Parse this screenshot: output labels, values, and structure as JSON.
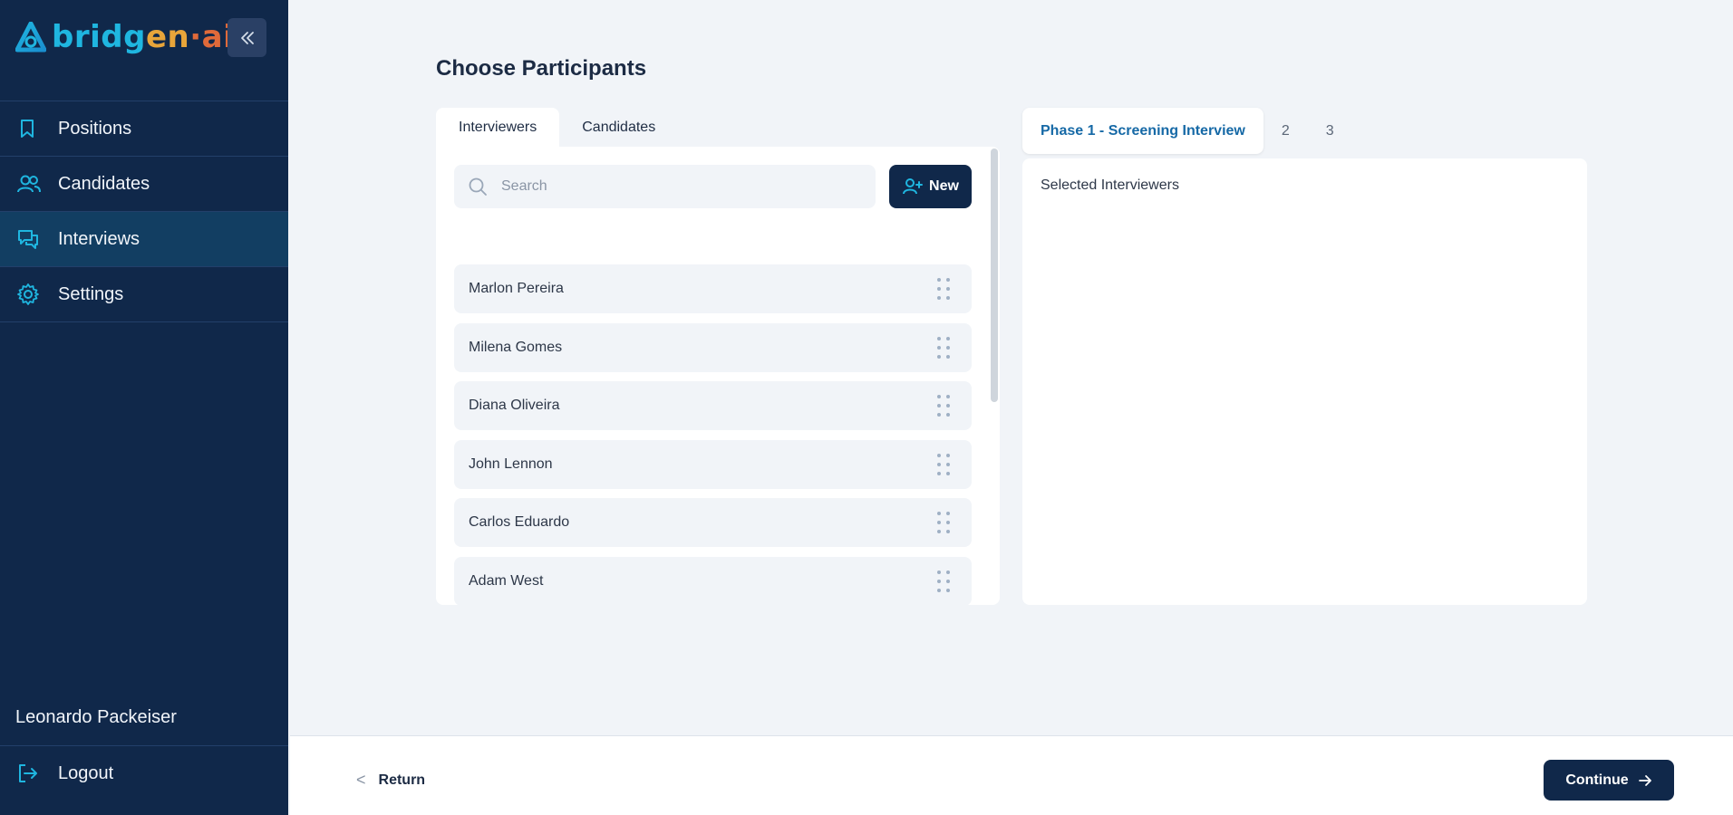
{
  "app": {
    "logo": {
      "part1": "bridg",
      "part2": "en",
      "part3": "·ai"
    }
  },
  "sidebar": {
    "items": [
      {
        "label": "Positions",
        "icon": "bookmark-icon",
        "active": false
      },
      {
        "label": "Candidates",
        "icon": "users-icon",
        "active": false
      },
      {
        "label": "Interviews",
        "icon": "chat-icon",
        "active": true
      },
      {
        "label": "Settings",
        "icon": "gear-icon",
        "active": false
      }
    ],
    "user_name": "Leonardo Packeiser",
    "logout_label": "Logout"
  },
  "main": {
    "title": "Choose Participants",
    "tabs": [
      {
        "label": "Interviewers",
        "active": true
      },
      {
        "label": "Candidates",
        "active": false
      }
    ],
    "search": {
      "placeholder": "Search",
      "value": ""
    },
    "new_button_label": "New",
    "participants": [
      {
        "name": "Marlon Pereira"
      },
      {
        "name": "Milena Gomes"
      },
      {
        "name": "Diana Oliveira"
      },
      {
        "name": "John Lennon"
      },
      {
        "name": "Carlos Eduardo"
      },
      {
        "name": "Adam West"
      }
    ]
  },
  "phases": {
    "tabs": [
      {
        "label": "Phase 1 - Screening Interview",
        "active": true
      },
      {
        "label": "2",
        "active": false
      },
      {
        "label": "3",
        "active": false
      }
    ],
    "selected_heading": "Selected Interviewers"
  },
  "footer": {
    "return_label": "Return",
    "continue_label": "Continue"
  },
  "colors": {
    "sidebar_bg": "#10284a",
    "accent": "#1fb6e0",
    "active_tab_text": "#1669a6"
  }
}
